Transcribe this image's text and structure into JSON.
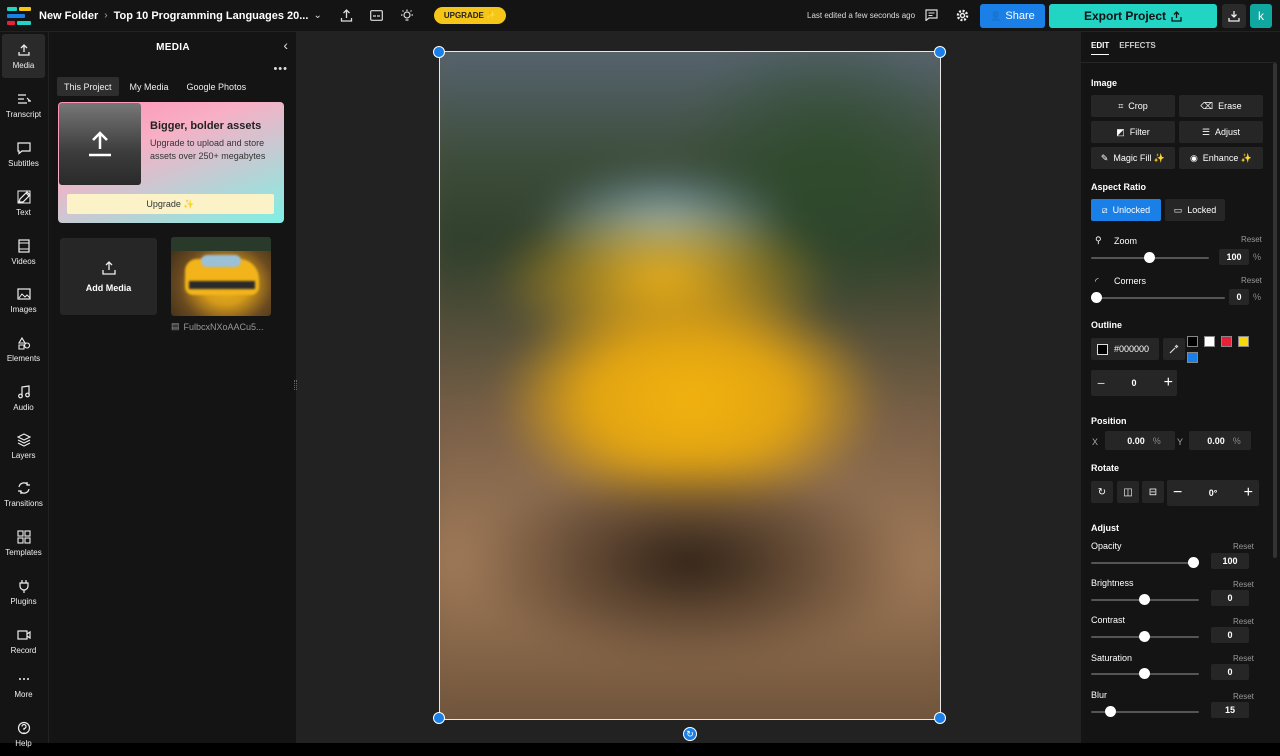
{
  "topbar": {
    "folder": "New Folder",
    "project_title": "Top 10 Programming Languages 20...",
    "upgrade_label": "UPGRADE ✨",
    "last_edited": "Last edited a few seconds ago",
    "share_label": "Share",
    "export_label": "Export Project",
    "avatar_letter": "k"
  },
  "iconbar": {
    "items": [
      {
        "label": "Media",
        "icon": "media-icon"
      },
      {
        "label": "Transcript",
        "icon": "transcript-icon"
      },
      {
        "label": "Subtitles",
        "icon": "subtitles-icon"
      },
      {
        "label": "Text",
        "icon": "text-icon"
      },
      {
        "label": "Videos",
        "icon": "videos-icon"
      },
      {
        "label": "Images",
        "icon": "images-icon"
      },
      {
        "label": "Elements",
        "icon": "elements-icon"
      },
      {
        "label": "Audio",
        "icon": "audio-icon"
      },
      {
        "label": "Layers",
        "icon": "layers-icon"
      },
      {
        "label": "Transitions",
        "icon": "transitions-icon"
      },
      {
        "label": "Templates",
        "icon": "templates-icon"
      },
      {
        "label": "Plugins",
        "icon": "plugins-icon"
      },
      {
        "label": "Record",
        "icon": "record-icon"
      },
      {
        "label": "More",
        "icon": "more-icon"
      },
      {
        "label": "Help",
        "icon": "help-icon"
      }
    ]
  },
  "media": {
    "title": "MEDIA",
    "tabs": [
      "This Project",
      "My Media",
      "Google Photos"
    ],
    "promo": {
      "title": "Bigger, bolder assets",
      "text": "Upgrade to upload and store assets over 250+ megabytes",
      "button": "Upgrade ✨"
    },
    "add_media": "Add Media",
    "file_name": "FulbcxNXoAACu5..."
  },
  "right": {
    "tabs": [
      "EDIT",
      "EFFECTS"
    ],
    "image_title": "Image",
    "image_buttons": [
      "Crop",
      "Erase",
      "Filter",
      "Adjust",
      "Magic Fill ✨",
      "Enhance ✨"
    ],
    "aspect_title": "Aspect Ratio",
    "aspect_unlocked": "Unlocked",
    "aspect_locked": "Locked",
    "zoom_label": "Zoom",
    "zoom_value": "100",
    "corners_label": "Corners",
    "corners_value": "0",
    "reset": "Reset",
    "percent": "%",
    "outline_title": "Outline",
    "outline_color": "#000000",
    "outline_width": "0",
    "swatches": [
      "#000000",
      "#ffffff",
      "#e8203a",
      "#f5d70a",
      "#1a7fe6"
    ],
    "position_title": "Position",
    "pos_x_label": "X",
    "pos_x": "0.00",
    "pos_y_label": "Y",
    "pos_y": "0.00",
    "rotate_title": "Rotate",
    "rotate_value": "0°",
    "adjust_title": "Adjust",
    "opacity_label": "Opacity",
    "opacity_value": "100",
    "brightness_label": "Brightness",
    "brightness_value": "0",
    "contrast_label": "Contrast",
    "contrast_value": "0",
    "saturation_label": "Saturation",
    "saturation_value": "0",
    "blur_label": "Blur",
    "blur_value": "15"
  },
  "colors": {
    "accent_blue": "#1a7fe6",
    "export_teal": "#21d4c4",
    "upgrade_yellow": "#f5c518"
  }
}
